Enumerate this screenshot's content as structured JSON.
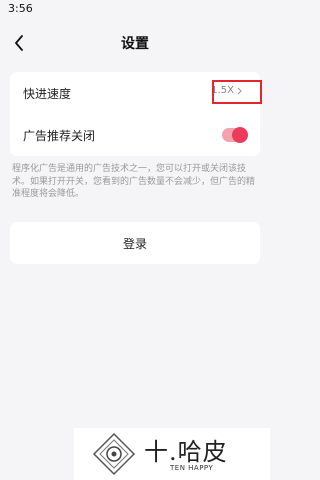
{
  "status_bar": {
    "time": "3:56"
  },
  "nav": {
    "title": "设置",
    "back_icon": "chevron-left-icon"
  },
  "settings": {
    "speed": {
      "label": "快进速度",
      "value": "1.5X"
    },
    "ad_toggle": {
      "label": "广告推荐关闭",
      "on": true
    }
  },
  "description": "程序化广告是通用的广告技术之一，您可以打开或关闭该技术。如果打开开关，您看到的广告数量不会减少，但广告的精准程度将会降低。",
  "login": {
    "label": "登录"
  },
  "watermark": {
    "cn": "十.哈皮",
    "en": "TEN HAPPY"
  },
  "colors": {
    "accent": "#ec3b5a",
    "highlight": "#e4262b",
    "background": "#f5f5f7"
  }
}
